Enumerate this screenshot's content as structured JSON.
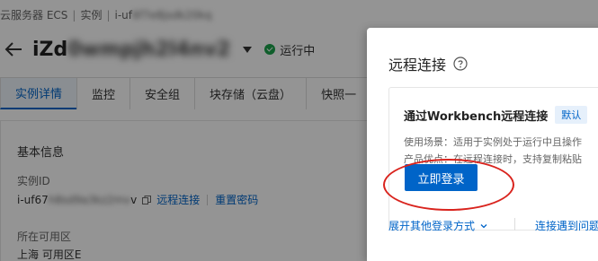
{
  "breadcrumb": {
    "items": [
      "云服务器 ECS",
      "实例",
      "i-uf"
    ],
    "redacted": "6f7e8jsdk20kq"
  },
  "instance": {
    "name_prefix": "iZd",
    "name_redacted": "0wmpjh2l4nv2",
    "status": "运行中",
    "status_color": "#1aa34a"
  },
  "tabs": [
    {
      "label": "实例详情",
      "active": true
    },
    {
      "label": "监控",
      "active": false
    },
    {
      "label": "安全组",
      "active": false
    },
    {
      "label": "块存储（云盘）",
      "active": false
    },
    {
      "label": "快照一",
      "active": false
    }
  ],
  "basic_info": {
    "title": "基本信息",
    "instance_id_label": "实例ID",
    "instance_id_prefix": "i-uf67",
    "instance_id_redacted": "h8sd9a3kz2mv",
    "instance_id_suffix": "v",
    "remote_connect": "远程连接",
    "reset_password": "重置密码",
    "zone_label": "所在可用区",
    "zone_value": "上海 可用区E"
  },
  "drawer": {
    "title": "远程连接",
    "help_icon": "question-circle-icon",
    "card": {
      "title": "通过Workbench远程连接",
      "badge": "默认",
      "usage": "使用场景：适用于实例处于运行中且操作",
      "advantage": "产品优点：在远程连接时，支持复制粘贴",
      "login_button": "立即登录"
    },
    "expand_link": "展开其他登录方式",
    "issue_link": "连接遇到问题"
  },
  "colors": {
    "accent": "#0064c8",
    "highlight": "#d9231d"
  }
}
